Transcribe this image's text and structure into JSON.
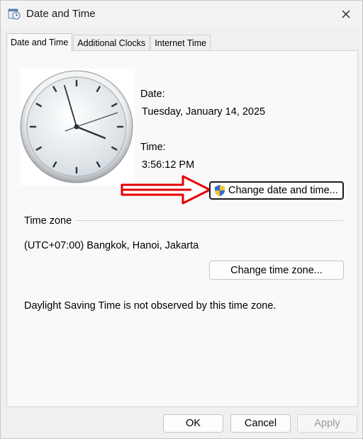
{
  "window": {
    "title": "Date and Time",
    "icon": "clock-calendar-icon"
  },
  "tabs": [
    {
      "label": "Date and Time",
      "active": true
    },
    {
      "label": "Additional Clocks",
      "active": false
    },
    {
      "label": "Internet Time",
      "active": false
    }
  ],
  "date": {
    "label": "Date:",
    "value": "Tuesday, January 14, 2025"
  },
  "time": {
    "label": "Time:",
    "value": "3:56:12 PM"
  },
  "change_datetime_button": {
    "label": "Change date and time...",
    "icon": "uac-shield-icon"
  },
  "annotation": {
    "icon": "red-arrow-icon",
    "color": "#e60000"
  },
  "timezone": {
    "heading": "Time zone",
    "value": "(UTC+07:00) Bangkok, Hanoi, Jakarta",
    "change_button": "Change time zone...",
    "dst_note": "Daylight Saving Time is not observed by this time zone."
  },
  "footer": {
    "ok": "OK",
    "cancel": "Cancel",
    "apply": "Apply",
    "apply_disabled": true
  }
}
